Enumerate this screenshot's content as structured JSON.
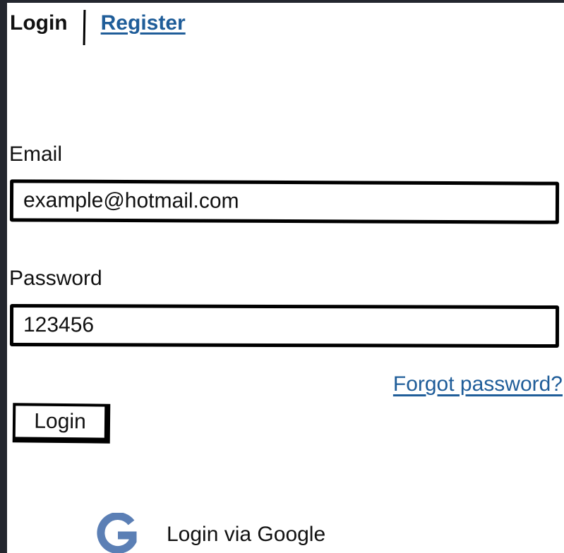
{
  "tabs": {
    "login_label": "Login",
    "register_label": "Register"
  },
  "form": {
    "email_label": "Email",
    "email_value": "example@hotmail.com",
    "password_label": "Password",
    "password_value": "123456",
    "forgot_label": "Forgot password?",
    "login_button_label": "Login"
  },
  "social": {
    "google_label": "Login via Google",
    "google_icon": "google-g-icon"
  },
  "colors": {
    "link": "#1f5d99",
    "google_icon": "#5b7fb5",
    "page_border": "#23262e"
  }
}
